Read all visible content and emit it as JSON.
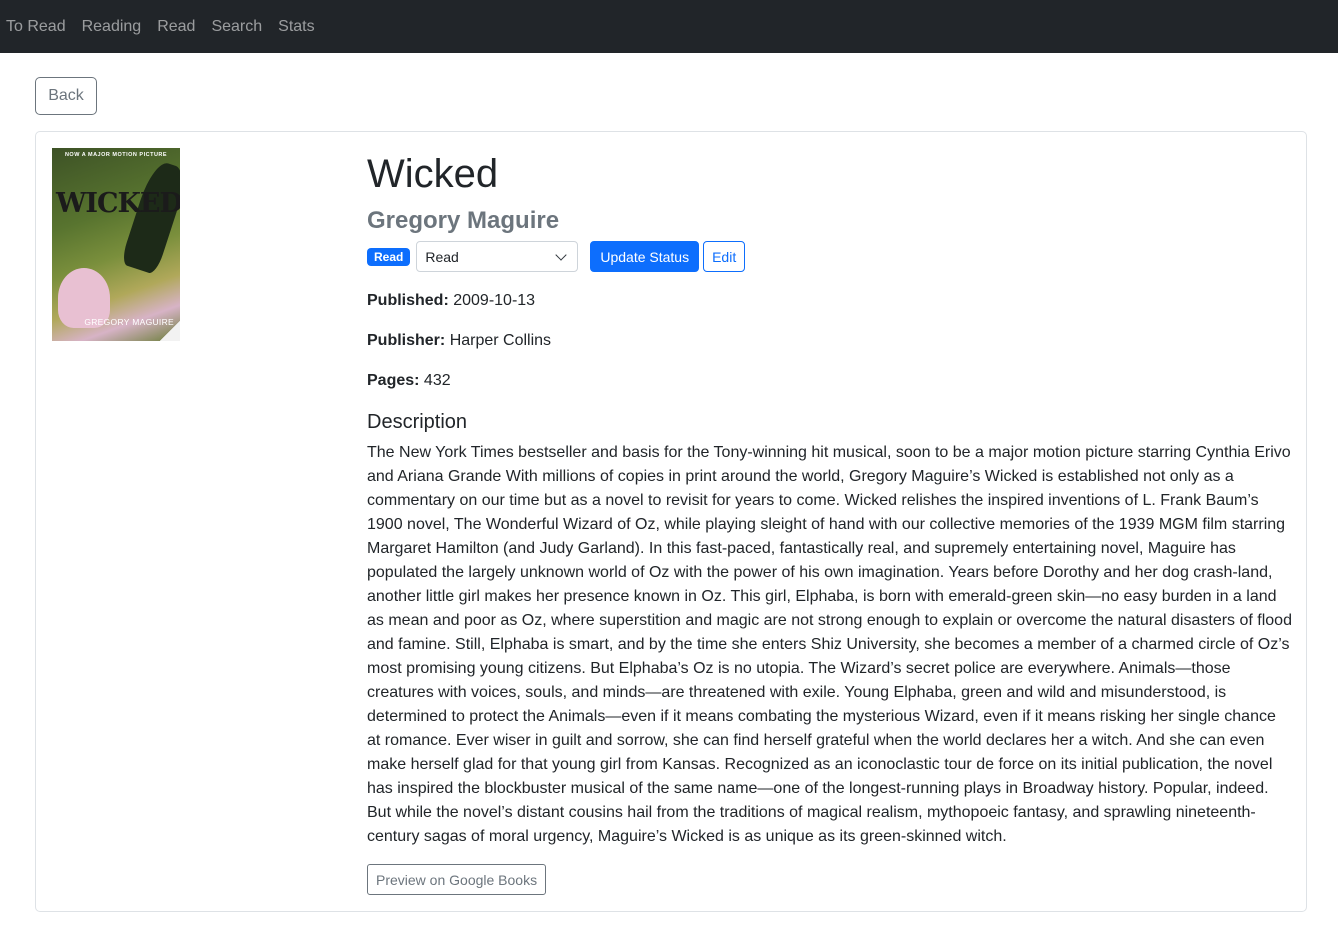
{
  "nav": {
    "items": [
      {
        "label": "To Read"
      },
      {
        "label": "Reading"
      },
      {
        "label": "Read"
      },
      {
        "label": "Search"
      },
      {
        "label": "Stats"
      }
    ]
  },
  "back_label": "Back",
  "book": {
    "cover": {
      "tagline": "NOW A MAJOR MOTION PICTURE",
      "title": "WICKED",
      "author": "GREGORY MAGUIRE"
    },
    "title": "Wicked",
    "author": "Gregory Maguire",
    "status_badge": "Read",
    "status_select_value": "Read",
    "update_status_label": "Update Status",
    "edit_label": "Edit",
    "published_label": "Published:",
    "published_value": "2009-10-13",
    "publisher_label": "Publisher:",
    "publisher_value": "Harper Collins",
    "pages_label": "Pages:",
    "pages_value": "432",
    "description_heading": "Description",
    "description": "The New York Times bestseller and basis for the Tony-winning hit musical, soon to be a major motion picture starring Cynthia Erivo and Ariana Grande With millions of copies in print around the world, Gregory Maguire’s Wicked is established not only as a commentary on our time but as a novel to revisit for years to come. Wicked relishes the inspired inventions of L. Frank Baum’s 1900 novel, The Wonderful Wizard of Oz, while playing sleight of hand with our collective memories of the 1939 MGM film starring Margaret Hamilton (and Judy Garland). In this fast-paced, fantastically real, and supremely entertaining novel, Maguire has populated the largely unknown world of Oz with the power of his own imagination.  Years before Dorothy and her dog crash-land, another little girl makes her presence known in Oz. This girl, Elphaba, is born with emerald-green skin—no easy burden in a land as mean and poor as Oz, where superstition and magic are not strong enough to explain or overcome the natural disasters of flood and famine. Still, Elphaba is smart, and by the time she enters Shiz University, she becomes a member of a charmed circle of Oz’s most promising young citizens. But Elphaba’s Oz is no utopia. The Wizard’s secret police are everywhere. Animals—those creatures with voices, souls, and minds—are threatened with exile. Young Elphaba, green and wild and misunderstood, is determined to protect the Animals—even if it means combating the mysterious Wizard, even if it means risking her single chance at romance. Ever wiser in guilt and sorrow, she can find herself grateful when the world declares her a witch. And she can even make herself glad for that young girl from Kansas.  Recognized as an iconoclastic tour de force on its initial publication, the novel has inspired the blockbuster musical of the same name—one of the longest-running plays in Broadway history. Popular, indeed. But while the novel’s distant cousins hail from the traditions of magical realism, mythopoeic fantasy, and sprawling nineteenth-century sagas of moral urgency, Maguire’s Wicked is as unique as its green-skinned witch.",
    "preview_label": "Preview on Google Books"
  }
}
